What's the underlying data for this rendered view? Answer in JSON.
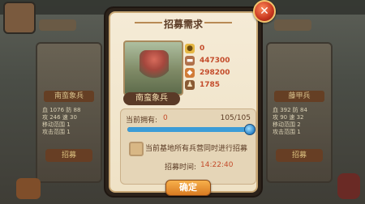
{
  "dialog": {
    "title": "招募需求",
    "close_symbol": "✕",
    "unit_name": "南蛮象兵",
    "resources": [
      {
        "icon": "gold-icon",
        "value": "0"
      },
      {
        "icon": "wood-icon",
        "value": "447300"
      },
      {
        "icon": "food-icon",
        "value": "298200"
      },
      {
        "icon": "soldier-icon",
        "value": "1785"
      }
    ],
    "current_label": "当前拥有:",
    "current_value": "0",
    "capacity_text": "105/105",
    "slider_fraction": 1.0,
    "checkbox_label": "当前基地所有兵营同时进行招募",
    "time_label": "招募时间:",
    "time_value": "14:22:40",
    "confirm_label": "确定"
  },
  "background": {
    "left_card": {
      "tag": "南蛮象兵",
      "stats": [
        "血 1076  防 88",
        "攻 246  速 30",
        "移动范围 1",
        "攻击范围 1"
      ],
      "button": "招募"
    },
    "right_card": {
      "tag": "藤甲兵",
      "stats": [
        "血 392  防 84",
        "攻 90  速 32",
        "移动范围 2",
        "攻击范围 1"
      ],
      "button": "招募"
    }
  },
  "colors": {
    "accent_red": "#c44c2b",
    "slider_blue": "#3b9cd7",
    "panel_bg": "#f5ebd6"
  }
}
